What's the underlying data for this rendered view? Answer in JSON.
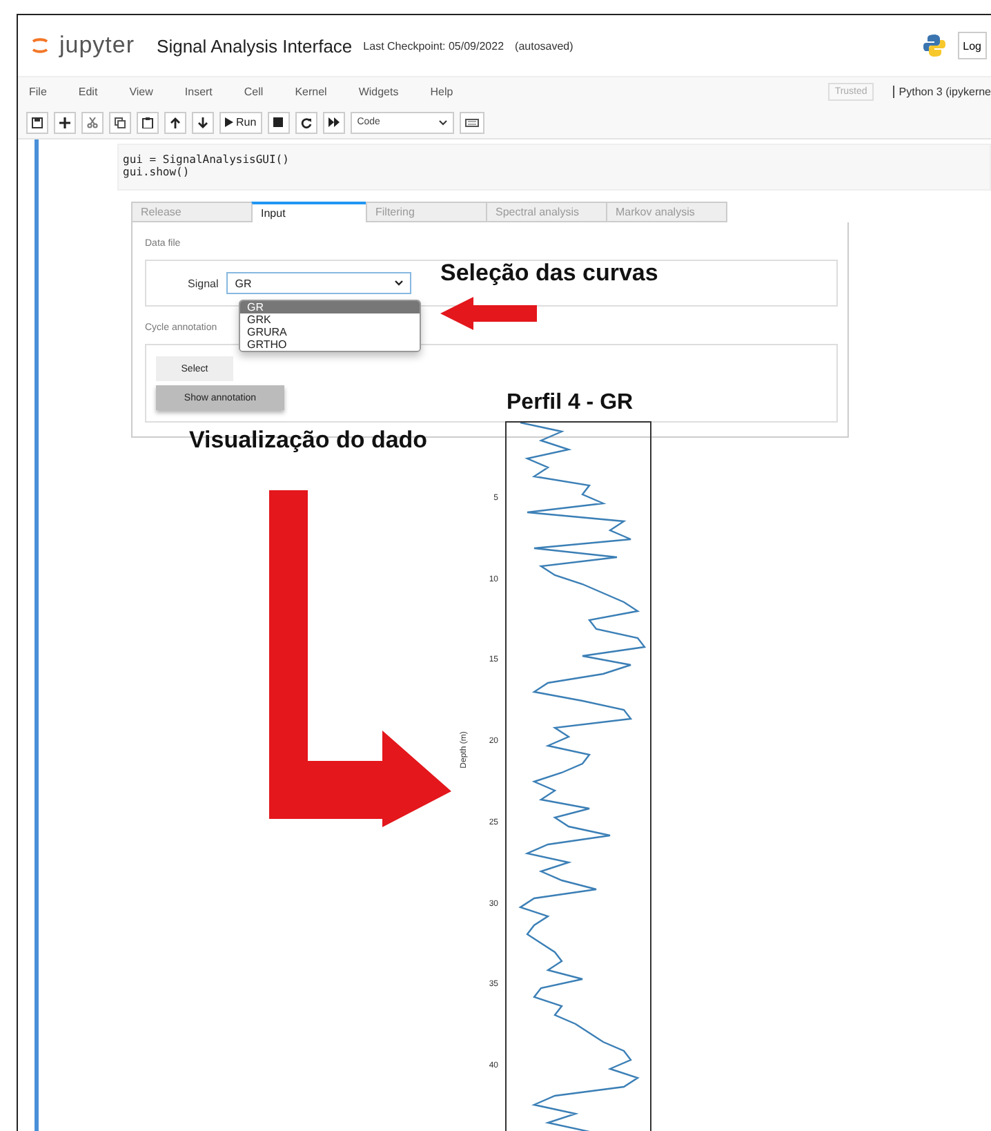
{
  "header": {
    "logo_text": "jupyter",
    "title": "Signal Analysis Interface",
    "checkpoint": "Last Checkpoint: 05/09/2022",
    "autosave": "(autosaved)",
    "login": "Log"
  },
  "menu": {
    "items": [
      "File",
      "Edit",
      "View",
      "Insert",
      "Cell",
      "Kernel",
      "Widgets",
      "Help"
    ],
    "trusted": "Trusted",
    "kernel": "Python 3 (ipykerne"
  },
  "toolbar": {
    "run": "Run",
    "cell_type": "Code"
  },
  "code": [
    "gui = SignalAnalysisGUI()",
    "gui.show()"
  ],
  "tabs": [
    {
      "label": "Release",
      "selected": false
    },
    {
      "label": "Input",
      "selected": true
    },
    {
      "label": "Filtering",
      "selected": false
    },
    {
      "label": "Spectral analysis",
      "selected": false
    },
    {
      "label": "Markov analysis",
      "selected": false
    }
  ],
  "data_file": {
    "label": "Data file",
    "signal_label": "Signal",
    "signal_value": "GR"
  },
  "dropdown": {
    "options": [
      {
        "label": "GR",
        "selected": true
      },
      {
        "label": "GRK",
        "selected": false
      },
      {
        "label": "GRURA",
        "selected": false
      },
      {
        "label": "GRTHO",
        "selected": false
      }
    ]
  },
  "cycle": {
    "label": "Cycle annotation",
    "select_button": "Select",
    "show_button": "Show annotation"
  },
  "annotations": {
    "curves": "Seleção das curvas",
    "view": "Visualização do dado"
  },
  "plot": {
    "title": "Perfil 4 - GR",
    "ylabel": "Depth (m)",
    "yticks": [
      "5",
      "10",
      "15",
      "20",
      "25",
      "30",
      "35",
      "40"
    ]
  }
}
